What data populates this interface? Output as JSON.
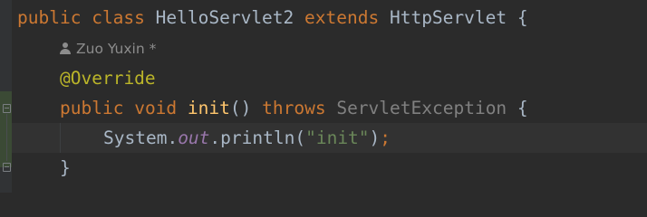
{
  "code": {
    "line1": {
      "public": "public",
      "class": "class",
      "classname": "HelloServlet2",
      "extends": "extends",
      "superclass": "HttpServlet",
      "brace": "{"
    },
    "author_hint": {
      "icon": "user-icon",
      "text": "Zuo Yuxin *"
    },
    "line3": {
      "annotation": "@Override"
    },
    "line4": {
      "public": "public",
      "void": "void",
      "method": "init",
      "parens": "()",
      "throws": "throws",
      "exception": "ServletException",
      "brace": "{"
    },
    "line5": {
      "object": "System.",
      "field": "out",
      "call": ".println(",
      "string": "\"init\"",
      "close": ")",
      "semicolon": ";"
    },
    "line6": {
      "brace": "}"
    }
  },
  "colors": {
    "background": "#2b2b2b",
    "keyword": "#cc7832",
    "annotation": "#bbb529",
    "method": "#ffc66d",
    "string": "#6a8759",
    "field": "#9876aa",
    "text": "#a9b7c6"
  }
}
